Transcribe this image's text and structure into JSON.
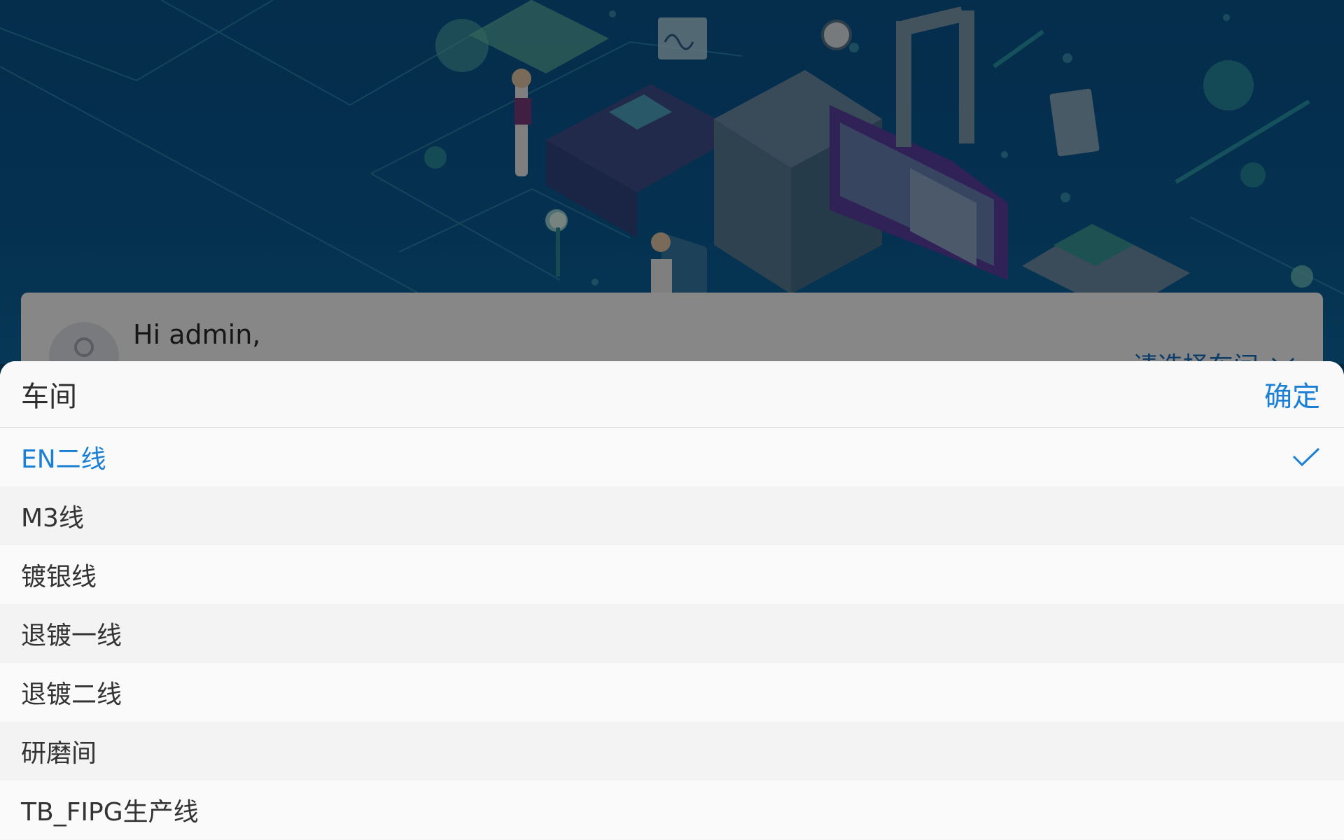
{
  "greeting": "Hi admin,",
  "workshop_select": {
    "placeholder": "请选择车间",
    "icon": "chevron-down-icon"
  },
  "picker": {
    "title": "车间",
    "confirm_label": "确定",
    "options": [
      {
        "label": "EN二线",
        "selected": true
      },
      {
        "label": "M3线",
        "selected": false
      },
      {
        "label": "镀银线",
        "selected": false
      },
      {
        "label": "退镀一线",
        "selected": false
      },
      {
        "label": "退镀二线",
        "selected": false
      },
      {
        "label": "研磨间",
        "selected": false
      },
      {
        "label": "TB_FIPG生产线",
        "selected": false
      }
    ],
    "check_icon": "check-icon"
  },
  "colors": {
    "accent": "#1b7fd4",
    "hero_bg": "#0b5590",
    "overlay": "rgba(0,0,0,0.47)"
  }
}
